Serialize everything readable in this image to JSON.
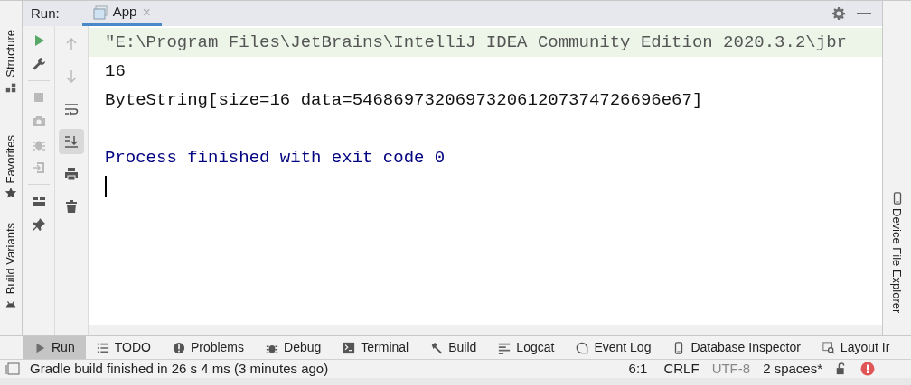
{
  "left_stripe": [
    {
      "label": "Structure",
      "kind": "structure"
    },
    {
      "label": "Favorites",
      "kind": "star"
    },
    {
      "label": "Build Variants",
      "kind": "android"
    }
  ],
  "header": {
    "title": "Run:",
    "tabs": [
      {
        "label": "App",
        "selected": true,
        "close": "×"
      }
    ]
  },
  "toolbar_main": [
    {
      "kind": "run",
      "disabled": false
    },
    {
      "kind": "wrench",
      "disabled": false
    },
    {
      "kind": "stop",
      "disabled": true
    },
    {
      "kind": "camera",
      "disabled": true
    },
    {
      "kind": "bug",
      "disabled": true
    },
    {
      "kind": "exit",
      "disabled": true
    },
    {
      "kind": "layout",
      "disabled": false
    },
    {
      "kind": "pin",
      "disabled": false
    }
  ],
  "toolbar_side": [
    {
      "kind": "up",
      "selected": false,
      "disabled": true
    },
    {
      "kind": "down",
      "selected": false,
      "disabled": true
    },
    {
      "kind": "wrap",
      "selected": false,
      "disabled": false
    },
    {
      "kind": "scroll",
      "selected": true,
      "disabled": false
    },
    {
      "kind": "print",
      "selected": false,
      "disabled": false
    },
    {
      "kind": "trash",
      "selected": false,
      "disabled": false
    }
  ],
  "console": {
    "lines": [
      {
        "kind": "command",
        "text": "\"E:\\Program Files\\JetBrains\\IntelliJ IDEA Community Edition 2020.3.2\\jbr"
      },
      {
        "kind": "output",
        "text": "16"
      },
      {
        "kind": "output",
        "text": "ByteString[size=16 data=546869732069732061207374726696e67]"
      },
      {
        "kind": "blank"
      },
      {
        "kind": "system",
        "text": "Process finished with exit code 0"
      }
    ]
  },
  "right_stripe": [
    {
      "label": "Device File Explorer",
      "kind": "phone"
    }
  ],
  "tool_tabs": [
    {
      "label": "Run",
      "kind": "run",
      "selected": true
    },
    {
      "label": "TODO",
      "kind": "list",
      "selected": false
    },
    {
      "label": "Problems",
      "kind": "alert",
      "selected": false
    },
    {
      "label": "Debug",
      "kind": "bug",
      "selected": false
    },
    {
      "label": "Terminal",
      "kind": "terminal",
      "selected": false
    },
    {
      "label": "Build",
      "kind": "hammer",
      "selected": false
    },
    {
      "label": "Logcat",
      "kind": "lines",
      "selected": false
    },
    {
      "label": "Event Log",
      "kind": "bubble",
      "selected": false
    },
    {
      "label": "Database Inspector",
      "kind": "phone",
      "selected": false
    },
    {
      "label": "Layout Ir",
      "kind": "inspect",
      "selected": false
    }
  ],
  "status_bar": {
    "message": "Gradle build finished in 26 s 4 ms (3 minutes ago)",
    "position": "6:1",
    "line_separator": "CRLF",
    "encoding": "UTF-8",
    "indent": "2 spaces*"
  }
}
